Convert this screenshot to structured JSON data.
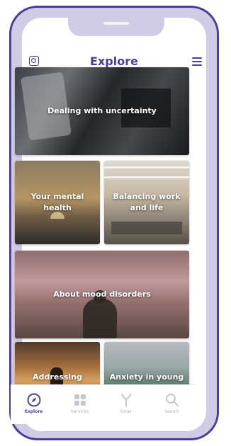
{
  "header": {
    "title": "Explore",
    "left_icon": "face-icon",
    "right_icon": "menu-icon"
  },
  "cards": {
    "uncertainty": "Dealing with uncertainty",
    "mental_health": "Your mental health",
    "work_life": "Balancing work and life",
    "mood_disorders": "About mood disorders",
    "addressing": "Addressing",
    "anxiety": "Anxiety in young"
  },
  "tabs": [
    {
      "label": "Explore",
      "icon": "compass-icon",
      "active": true
    },
    {
      "label": "Services",
      "icon": "grid-icon",
      "active": false
    },
    {
      "label": "Grow",
      "icon": "sprout-icon",
      "active": false
    },
    {
      "label": "Search",
      "icon": "search-icon",
      "active": false
    }
  ],
  "colors": {
    "accent": "#4a3f96",
    "frame": "#d2cbe6",
    "inactive": "#b0adb8"
  }
}
